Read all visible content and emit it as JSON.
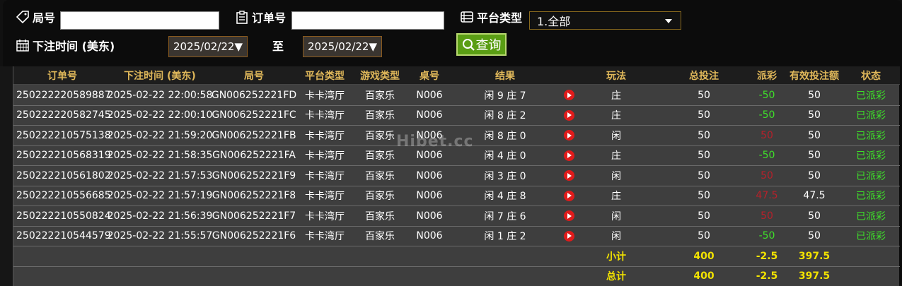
{
  "filters": {
    "round_label": "局号",
    "round_value": "",
    "order_label": "订单号",
    "order_value": "",
    "platform_label": "平台类型",
    "platform_selected": "1.全部",
    "bet_time_label": "下注时间 (美东)",
    "date_from": "2025/02/22▼",
    "to_label": "至",
    "date_to": "2025/02/22▼",
    "query_label": "查询"
  },
  "table": {
    "headers": [
      "订单号",
      "下注时间 (美东)",
      "局号",
      "平台类型",
      "游戏类型",
      "桌号",
      "结果",
      "",
      "玩法",
      "总投注",
      "派彩",
      "有效投注额",
      "状态"
    ],
    "rows": [
      {
        "order": "250222220589887",
        "time": "2025-02-22 22:00:58",
        "round": "GN006252221FD",
        "platform": "卡卡湾厅",
        "game": "百家乐",
        "table": "N006",
        "result": "闲 9 庄 7",
        "play": "庄",
        "bet": "50",
        "payout": "-50",
        "payout_color": "green",
        "valid": "50",
        "status": "已派彩"
      },
      {
        "order": "250222220582745",
        "time": "2025-02-22 22:00:10",
        "round": "GN006252221FC",
        "platform": "卡卡湾厅",
        "game": "百家乐",
        "table": "N006",
        "result": "闲 8 庄 2",
        "play": "庄",
        "bet": "50",
        "payout": "-50",
        "payout_color": "green",
        "valid": "50",
        "status": "已派彩"
      },
      {
        "order": "250222210575138",
        "time": "2025-02-22 21:59:20",
        "round": "GN006252221FB",
        "platform": "卡卡湾厅",
        "game": "百家乐",
        "table": "N006",
        "result": "闲 8 庄 0",
        "play": "闲",
        "bet": "50",
        "payout": "50",
        "payout_color": "red",
        "valid": "50",
        "status": "已派彩"
      },
      {
        "order": "250222210568319",
        "time": "2025-02-22 21:58:35",
        "round": "GN006252221FA",
        "platform": "卡卡湾厅",
        "game": "百家乐",
        "table": "N006",
        "result": "闲 4 庄 0",
        "play": "庄",
        "bet": "50",
        "payout": "-50",
        "payout_color": "green",
        "valid": "50",
        "status": "已派彩"
      },
      {
        "order": "250222210561802",
        "time": "2025-02-22 21:57:53",
        "round": "GN006252221F9",
        "platform": "卡卡湾厅",
        "game": "百家乐",
        "table": "N006",
        "result": "闲 3 庄 0",
        "play": "闲",
        "bet": "50",
        "payout": "50",
        "payout_color": "red",
        "valid": "50",
        "status": "已派彩"
      },
      {
        "order": "250222210556685",
        "time": "2025-02-22 21:57:19",
        "round": "GN006252221F8",
        "platform": "卡卡湾厅",
        "game": "百家乐",
        "table": "N006",
        "result": "闲 4 庄 8",
        "play": "庄",
        "bet": "50",
        "payout": "47.5",
        "payout_color": "red",
        "valid": "47.5",
        "status": "已派彩"
      },
      {
        "order": "250222210550824",
        "time": "2025-02-22 21:56:39",
        "round": "GN006252221F7",
        "platform": "卡卡湾厅",
        "game": "百家乐",
        "table": "N006",
        "result": "闲 7 庄 6",
        "play": "闲",
        "bet": "50",
        "payout": "50",
        "payout_color": "red",
        "valid": "50",
        "status": "已派彩"
      },
      {
        "order": "250222210544579",
        "time": "2025-02-22 21:55:57",
        "round": "GN006252221F6",
        "platform": "卡卡湾厅",
        "game": "百家乐",
        "table": "N006",
        "result": "闲 1 庄 2",
        "play": "闲",
        "bet": "50",
        "payout": "-50",
        "payout_color": "green",
        "valid": "50",
        "status": "已派彩"
      }
    ],
    "subtotal": {
      "label": "小计",
      "bet": "400",
      "payout": "-2.5",
      "valid": "397.5"
    },
    "total": {
      "label": "总计",
      "bet": "400",
      "payout": "-2.5",
      "valid": "397.5"
    }
  },
  "watermark": "Hibet.cc",
  "colors": {
    "accent_gold": "#e0b85a",
    "win_green": "#3ee02a",
    "loss_red": "#b8202a",
    "sum_yellow": "#f2e200",
    "query_green": "#5a9e14"
  }
}
